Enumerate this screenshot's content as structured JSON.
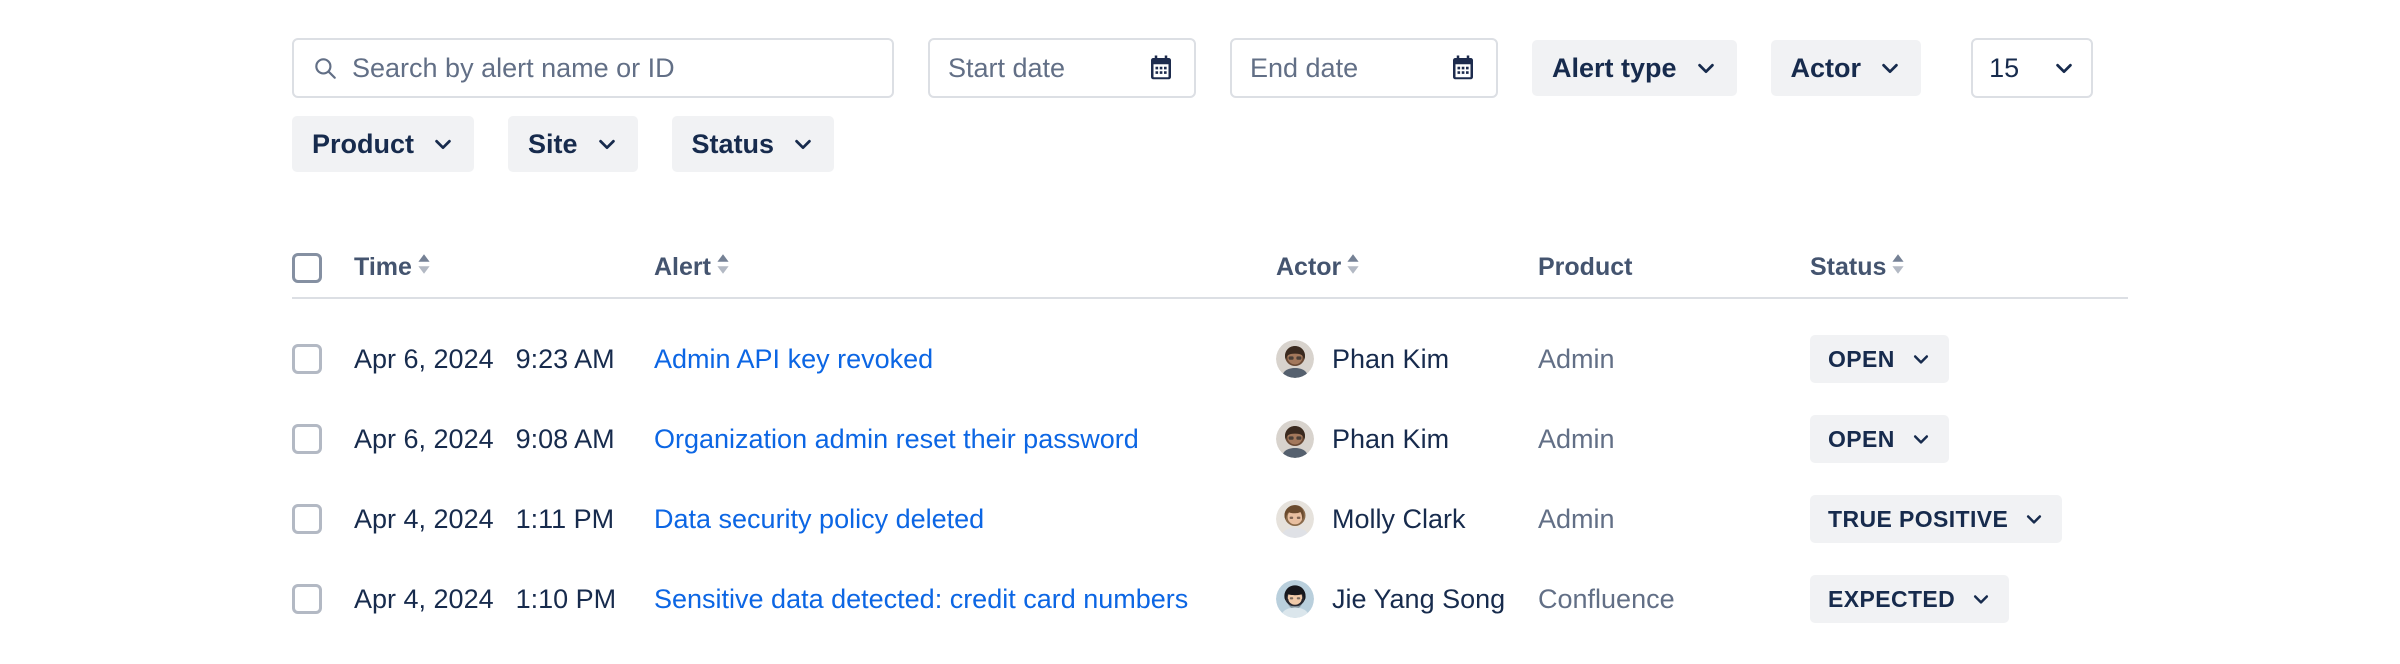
{
  "theme": {
    "link_color": "#0c66e4",
    "text_color": "#172b4d",
    "subtle_text_color": "#626f86",
    "header_text_color": "#44546f",
    "border_color": "#dcdfe4",
    "subtle_bg": "#f1f2f4",
    "page_bg": "#ffffff"
  },
  "filters": {
    "search": {
      "placeholder": "Search by alert name or ID",
      "value": "",
      "icon": "search-icon"
    },
    "start_date": {
      "placeholder": "Start date",
      "value": "",
      "icon": "calendar-icon"
    },
    "end_date": {
      "placeholder": "End date",
      "value": "",
      "icon": "calendar-icon"
    },
    "dropdowns": [
      {
        "label": "Alert type",
        "icon": "chevron-down-icon"
      },
      {
        "label": "Actor",
        "icon": "chevron-down-icon"
      },
      {
        "label": "Product",
        "icon": "chevron-down-icon"
      },
      {
        "label": "Site",
        "icon": "chevron-down-icon"
      },
      {
        "label": "Status",
        "icon": "chevron-down-icon"
      }
    ],
    "page_size": {
      "value": "15",
      "icon": "chevron-down-icon"
    }
  },
  "table": {
    "select_all": {
      "checked": false
    },
    "columns": [
      {
        "label": "Time",
        "sortable": true
      },
      {
        "label": "Alert",
        "sortable": true
      },
      {
        "label": "Actor",
        "sortable": true
      },
      {
        "label": "Product",
        "sortable": false
      },
      {
        "label": "Status",
        "sortable": true
      }
    ],
    "rows": [
      {
        "checked": false,
        "date": "Apr 6, 2024",
        "time": "9:23 AM",
        "alert": "Admin API key revoked",
        "actor": "Phan Kim",
        "avatar": "avatar-phan-kim",
        "product": "Admin",
        "status": "OPEN"
      },
      {
        "checked": false,
        "date": "Apr 6, 2024",
        "time": "9:08 AM",
        "alert": "Organization admin reset their password",
        "actor": "Phan Kim",
        "avatar": "avatar-phan-kim",
        "product": "Admin",
        "status": "OPEN"
      },
      {
        "checked": false,
        "date": "Apr 4, 2024",
        "time": "1:11 PM",
        "alert": "Data security policy deleted",
        "actor": "Molly Clark",
        "avatar": "avatar-molly-clark",
        "product": "Admin",
        "status": "TRUE POSITIVE"
      },
      {
        "checked": false,
        "date": "Apr 4, 2024",
        "time": "1:10 PM",
        "alert": "Sensitive data detected: credit card numbers",
        "actor": "Jie Yang Song",
        "avatar": "avatar-jie-yang-song",
        "product": "Confluence",
        "status": "EXPECTED"
      }
    ]
  }
}
